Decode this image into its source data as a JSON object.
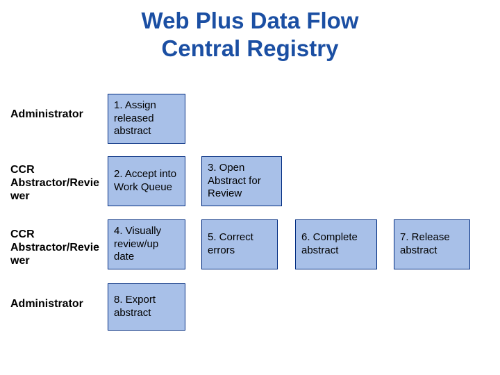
{
  "title_line1": "Web Plus Data Flow",
  "title_line2": "Central Registry",
  "rows": {
    "r1": {
      "role": "Administrator",
      "box1": "1. Assign released abstract"
    },
    "r2": {
      "role": "CCR Abstractor/Reviewer",
      "box1": "2. Accept into Work Queue",
      "box2": "3. Open Abstract for Review"
    },
    "r3": {
      "role": "CCR Abstractor/Reviewer",
      "box1": "4. Visually review/up date",
      "box2": "5. Correct errors",
      "box3": "6. Complete abstract",
      "box4": "7. Release abstract"
    },
    "r4": {
      "role": "Administrator",
      "box1": "8. Export abstract"
    }
  }
}
